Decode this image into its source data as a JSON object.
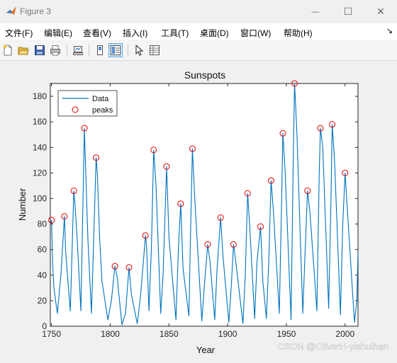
{
  "window": {
    "title": "Figure 3",
    "minimize_glyph": "—",
    "maximize_glyph": "☐",
    "close_glyph": "✕",
    "app_icon": "matlab-icon"
  },
  "menu": {
    "items": [
      "文件(F)",
      "编辑(E)",
      "查看(V)",
      "插入(I)",
      "工具(T)",
      "桌面(D)",
      "窗口(W)",
      "帮助(H)"
    ],
    "dock_arrow": "↘"
  },
  "toolbar": {
    "buttons": [
      "new-figure-icon",
      "open-file-icon",
      "save-icon",
      "print-icon",
      "link-plot-icon",
      "hide-plot-tools-icon",
      "show-plot-tools-icon",
      "edit-plot-arrow-icon",
      "open-property-inspector-icon"
    ]
  },
  "watermark": "CSDN @OliverH-yishuihan",
  "chart_data": {
    "type": "line",
    "title": "Sunspots",
    "xlabel": "Year",
    "ylabel": "Number",
    "xlim": [
      1749,
      2011
    ],
    "ylim": [
      0,
      190
    ],
    "xticks": [
      1750,
      1800,
      1850,
      1900,
      1950,
      2000
    ],
    "yticks": [
      0,
      20,
      40,
      60,
      80,
      100,
      120,
      140,
      160,
      180
    ],
    "grid": false,
    "legend": {
      "position": "top-left",
      "entries": [
        "Data",
        "peaks"
      ]
    },
    "colors": {
      "data": "#0072BD",
      "peaks": "#e00000"
    },
    "series": [
      {
        "name": "Data",
        "x": [
          1749,
          1750,
          1751,
          1752,
          1755,
          1758,
          1761,
          1762,
          1764,
          1766,
          1769,
          1770,
          1772,
          1775,
          1778,
          1779,
          1781,
          1784,
          1788,
          1789,
          1791,
          1793,
          1798,
          1801,
          1804,
          1806,
          1810,
          1813,
          1816,
          1818,
          1823,
          1826,
          1830,
          1831,
          1833,
          1835,
          1837,
          1839,
          1843,
          1845,
          1848,
          1850,
          1856,
          1858,
          1860,
          1862,
          1867,
          1868,
          1870,
          1872,
          1878,
          1880,
          1883,
          1885,
          1889,
          1891,
          1894,
          1896,
          1901,
          1903,
          1905,
          1907,
          1913,
          1915,
          1917,
          1919,
          1923,
          1925,
          1928,
          1930,
          1933,
          1935,
          1937,
          1939,
          1944,
          1946,
          1947,
          1949,
          1954,
          1956,
          1957,
          1959,
          1964,
          1966,
          1968,
          1970,
          1976,
          1978,
          1979,
          1981,
          1986,
          1988,
          1989,
          1991,
          1996,
          1998,
          2000,
          2002,
          2008,
          2010,
          2011
        ],
        "y": [
          80,
          83,
          48,
          30,
          10,
          40,
          86,
          60,
          35,
          12,
          106,
          95,
          66,
          12,
          155,
          125,
          68,
          10,
          132,
          120,
          68,
          35,
          5,
          20,
          47,
          38,
          1,
          10,
          46,
          25,
          2,
          25,
          71,
          62,
          12,
          60,
          138,
          110,
          10,
          40,
          125,
          70,
          5,
          60,
          96,
          45,
          8,
          55,
          139,
          100,
          4,
          30,
          64,
          50,
          5,
          45,
          85,
          55,
          3,
          30,
          64,
          50,
          2,
          40,
          104,
          75,
          6,
          50,
          78,
          35,
          6,
          50,
          114,
          90,
          10,
          100,
          151,
          120,
          5,
          140,
          190,
          150,
          10,
          60,
          106,
          90,
          12,
          120,
          155,
          140,
          14,
          100,
          158,
          130,
          9,
          80,
          120,
          90,
          3,
          20,
          58
        ]
      },
      {
        "name": "peaks",
        "x": [
          1750,
          1761,
          1769,
          1778,
          1788,
          1804,
          1816,
          1830,
          1837,
          1848,
          1860,
          1870,
          1883,
          1894,
          1905,
          1917,
          1928,
          1937,
          1947,
          1957,
          1968,
          1979,
          1989,
          2000
        ],
        "y": [
          83,
          86,
          106,
          155,
          132,
          47,
          46,
          71,
          138,
          125,
          96,
          139,
          64,
          85,
          64,
          104,
          78,
          114,
          151,
          190,
          106,
          155,
          158,
          120
        ]
      }
    ]
  }
}
